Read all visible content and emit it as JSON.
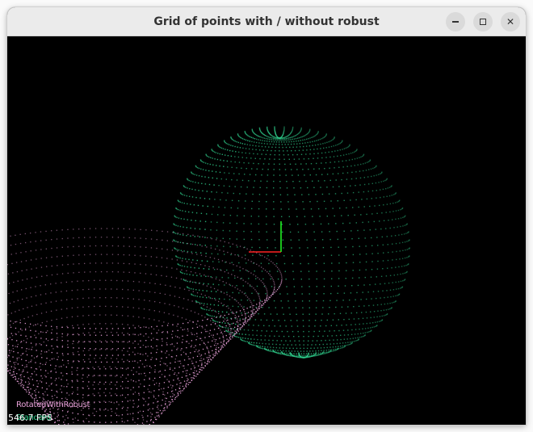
{
  "window": {
    "title": "Grid of points with / without robust"
  },
  "controls": {
    "minimize": "minimize-icon",
    "maximize": "maximize-icon",
    "close": "close-icon",
    "close_glyph": "✕"
  },
  "legend": {
    "rotated_label": "RotatedWithRobust",
    "rotated_color": "#e8a0d8",
    "standard_label": "Standard",
    "standard_color": "#2fcf8c"
  },
  "status": {
    "fps": "546.7 FPS"
  },
  "colors": {
    "axis_x": "#ff2222",
    "axis_y": "#22ff22",
    "background": "#000000"
  }
}
